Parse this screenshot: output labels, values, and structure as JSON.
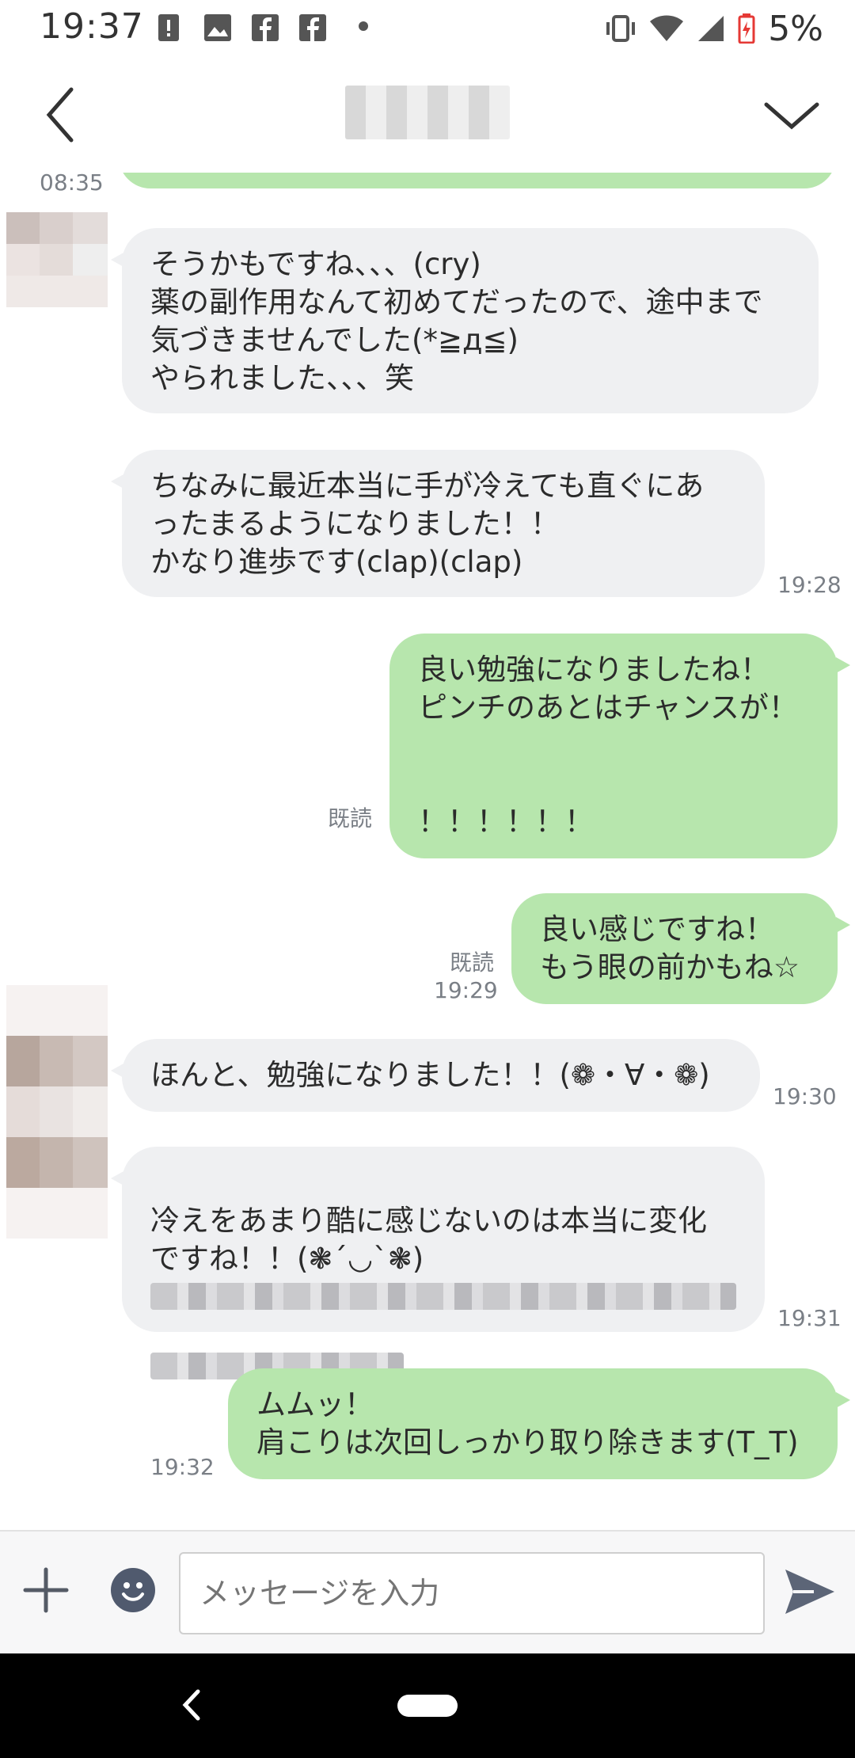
{
  "status_bar": {
    "time": "19:37",
    "battery": "5%"
  },
  "header": {
    "title": "▒▒▒▒▒"
  },
  "chat": {
    "top_time": "08:35",
    "messages": [
      {
        "text": "そうかもですね、、、(cry)\n薬の副作用なんて初めてだったので、途中まで\n気づきませんでした(*≧д≦)\nやられました、、、笑"
      },
      {
        "text": "ちなみに最近本当に手が冷えても直ぐにあ\nったまるようになりました！！\nかなり進歩です(clap)(clap)",
        "time": "19:28"
      },
      {
        "text": "良い勉強になりましたね！\nピンチのあとはチャンスが！\n\n\n！！！！！！",
        "read": "既読"
      },
      {
        "text": "良い感じですね！\nもう眼の前かもね☆",
        "read": "既読",
        "time": "19:29"
      },
      {
        "text": "ほんと、勉強になりました！！(❁・∀・❁)",
        "time": "19:30"
      },
      {
        "text": "冷えをあまり酷に感じないのは本当に変化\nですね！！(❃´◡`❃)",
        "time": "19:31"
      },
      {
        "text": "ムムッ！\n肩こりは次回しっかり取り除きます(T_T)",
        "time": "19:32"
      }
    ]
  },
  "input": {
    "placeholder": "メッセージを入力"
  },
  "icons": {
    "back": "chevron-left-icon",
    "menu": "chevron-down-icon",
    "plus": "plus-icon",
    "emoji": "smiley-icon",
    "send": "send-icon"
  },
  "colors": {
    "outgoing": "#b7e6ad",
    "incoming": "#eff0f2",
    "accent_send": "#5c6577"
  }
}
